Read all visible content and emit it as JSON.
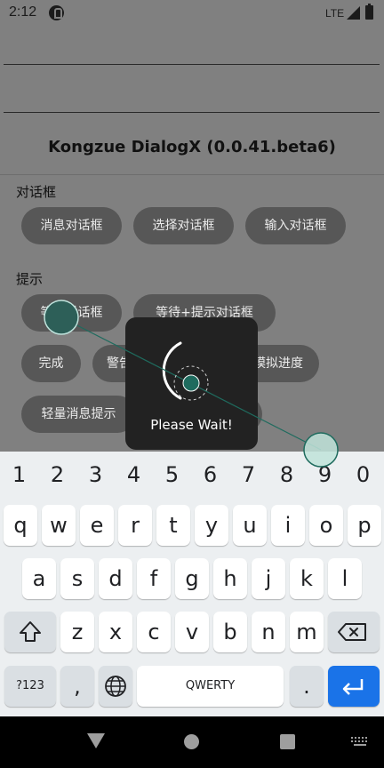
{
  "status_bar": {
    "time": "2:12",
    "network": "LTE"
  },
  "app": {
    "title": "Kongzue DialogX (0.0.41.beta6)",
    "sections": [
      {
        "label": "对话框",
        "buttons": [
          "消息对话框",
          "选择对话框",
          "输入对话框"
        ]
      },
      {
        "label": "提示",
        "buttons": [
          "等待对话框",
          "等待+提示对话框",
          "完成",
          "警告",
          "模拟进度",
          "轻量消息提示"
        ]
      }
    ]
  },
  "wait_dialog": {
    "text": "Please Wait!"
  },
  "keyboard": {
    "number_row": [
      "1",
      "2",
      "3",
      "4",
      "5",
      "6",
      "7",
      "8",
      "9",
      "0"
    ],
    "row1": [
      "q",
      "w",
      "e",
      "r",
      "t",
      "y",
      "u",
      "i",
      "o",
      "p"
    ],
    "row2": [
      "a",
      "s",
      "d",
      "f",
      "g",
      "h",
      "j",
      "k",
      "l"
    ],
    "row3": [
      "z",
      "x",
      "c",
      "v",
      "b",
      "n",
      "m"
    ],
    "symbols_label": "?123",
    "comma": ",",
    "space_label": "QWERTY",
    "period": "."
  },
  "colors": {
    "accent": "#1a73e8",
    "touch_indicator": "#1f6b5e",
    "dialog_bg": "#222222"
  }
}
